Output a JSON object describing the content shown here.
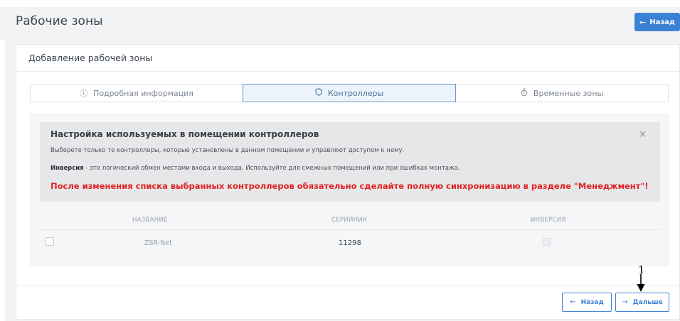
{
  "header": {
    "title": "Рабочие зоны",
    "back_label": "Назад",
    "back_icon": "arrow-left-icon"
  },
  "card": {
    "title": "Добавление рабочей зоны"
  },
  "tabs": [
    {
      "label": "Подробная информация",
      "icon": "info-circle-icon",
      "active": false
    },
    {
      "label": "Контроллеры",
      "icon": "shield-icon",
      "active": true
    },
    {
      "label": "Временные зоны",
      "icon": "stopwatch-icon",
      "active": false
    }
  ],
  "notice": {
    "title": "Настройка используемых в помещении контроллеров",
    "close": "×",
    "line1": "Выберете только те контроллеры, которые установлены в данном помещении и управляют доступом к нему.",
    "line2_bold": "Инверсия",
    "line2_rest": " - это логический обмен местами входа и выхода. Используйте для смежных помещений или при ошибках монтажа.",
    "warning": "После изменения списка выбранных контроллеров обязательно сделайте полную синхронизацию в разделе \"Менеджмент\"!"
  },
  "table": {
    "columns": [
      "НАЗВАНИЕ",
      "СЕРИЙНИК",
      "ИНВЕРСИЯ"
    ],
    "rows": [
      {
        "name": "ZSR-Net",
        "serial": "11298",
        "selected": false,
        "inversion": false
      }
    ]
  },
  "footer": {
    "back_label": "Назад",
    "next_label": "Дальше"
  },
  "annotation": {
    "number": "1"
  },
  "colors": {
    "accent": "#3b82d6",
    "warning": "#e02222"
  }
}
